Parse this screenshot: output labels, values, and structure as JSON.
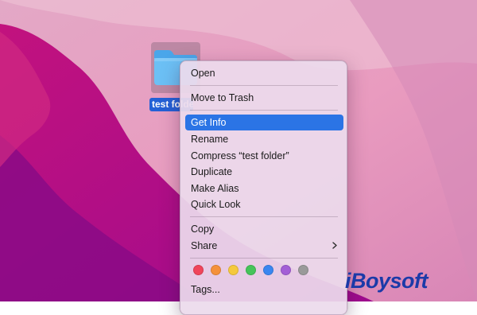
{
  "desktop": {
    "folder_name": "test folder"
  },
  "context_menu": {
    "items": [
      {
        "label": "Open"
      },
      {
        "label": "Move to Trash"
      },
      {
        "label": "Get Info",
        "selected": true
      },
      {
        "label": "Rename"
      },
      {
        "label": "Compress “test folder”"
      },
      {
        "label": "Duplicate"
      },
      {
        "label": "Make Alias"
      },
      {
        "label": "Quick Look"
      },
      {
        "label": "Copy"
      },
      {
        "label": "Share",
        "has_submenu": true
      },
      {
        "label": "Tags..."
      }
    ],
    "tag_colors": [
      {
        "name": "red",
        "color": "#f0455b"
      },
      {
        "name": "orange",
        "color": "#f5913b"
      },
      {
        "name": "yellow",
        "color": "#f5c93d"
      },
      {
        "name": "green",
        "color": "#45c45a"
      },
      {
        "name": "blue",
        "color": "#3a86f0"
      },
      {
        "name": "purple",
        "color": "#a35fd6"
      },
      {
        "name": "gray",
        "color": "#9a9a9a"
      }
    ],
    "selected_color": "#2b74e5"
  },
  "watermark": {
    "text": "iBoysoft",
    "color": "#1b3aa8"
  }
}
